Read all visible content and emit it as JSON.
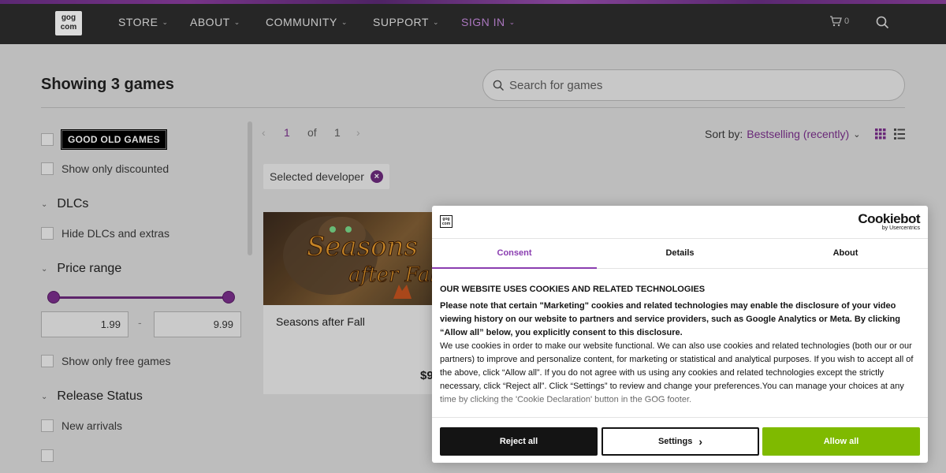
{
  "nav": {
    "logo_line1": "gog",
    "logo_line2": "com",
    "items": [
      {
        "label": "STORE"
      },
      {
        "label": "ABOUT"
      },
      {
        "label": "COMMUNITY"
      },
      {
        "label": "SUPPORT"
      },
      {
        "label": "SIGN IN"
      }
    ],
    "cart_count": "0",
    "accent": "#c68ade"
  },
  "header": {
    "title": "Showing 3 games",
    "search_placeholder": "Search for games"
  },
  "filters": {
    "good_old_games": "GOOD OLD GAMES",
    "show_discounted": "Show only discounted",
    "dlcs_title": "DLCs",
    "hide_dlcs": "Hide DLCs and extras",
    "price_title": "Price range",
    "price_min": "1.99",
    "price_max": "9.99",
    "price_dash": "-",
    "show_free": "Show only free games",
    "release_title": "Release Status",
    "new_arrivals": "New arrivals"
  },
  "pager": {
    "current": "1",
    "of": "of",
    "total": "1"
  },
  "sort": {
    "label": "Sort by:",
    "value": "Bestselling (recently)"
  },
  "chip": {
    "label": "Selected developer"
  },
  "card": {
    "title": "Seasons after Fall",
    "art_title_1": "Seasons",
    "art_title_2": "after Fall",
    "price": "$9"
  },
  "cookie": {
    "logo_line1": "gog",
    "logo_line2": "com",
    "brand": "Cookiebot",
    "brand_sub": "by Usercentrics",
    "tabs": [
      {
        "label": "Consent"
      },
      {
        "label": "Details"
      },
      {
        "label": "About"
      }
    ],
    "heading": "OUR WEBSITE USES COOKIES AND RELATED TECHNOLOGIES",
    "bold_para": "Please note that certain \"Marketing\" cookies and related technologies may enable the disclosure of your video viewing history on our website to partners and service providers, such as Google Analytics or Meta. By clicking “Allow all” below, you explicitly consent to this disclosure.",
    "para": "We use cookies in order to make our website functional. We can also use cookies and related technologies (both our or our partners) to improve and personalize content, for marketing or statistical and analytical purposes. If you wish to accept all of the above, click “Allow all”. If you do not agree with us using any cookies and related technologies except the strictly necessary, click “Reject all”. Click “Settings” to review and change your preferences.You can manage your choices at any time by clicking the 'Cookie Declaration' button in the GOG footer.",
    "reject": "Reject all",
    "settings": "Settings",
    "allow": "Allow all",
    "accent": "#8a3db0",
    "allow_color": "#7fba00"
  }
}
